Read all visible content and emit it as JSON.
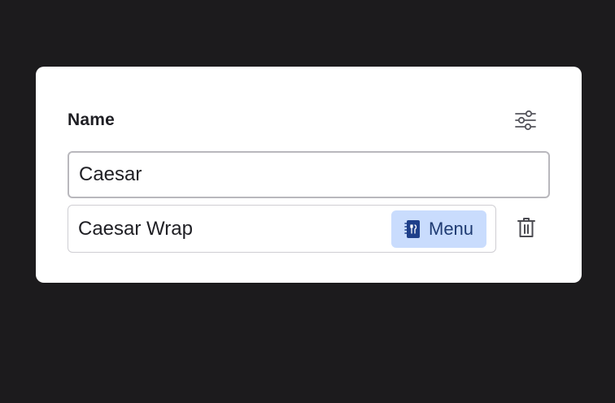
{
  "field": {
    "label": "Name",
    "value": "Caesar"
  },
  "item": {
    "name": "Caesar Wrap",
    "chip_label": "Menu",
    "chip_icon": "menu-book-icon"
  },
  "icons": {
    "filter": "sliders-icon",
    "delete": "trash-icon"
  },
  "colors": {
    "background": "#1c1b1d",
    "card": "#ffffff",
    "chip_bg": "#c9dcfd",
    "chip_text": "#1f3b73",
    "chip_icon": "#1e3f8a"
  }
}
